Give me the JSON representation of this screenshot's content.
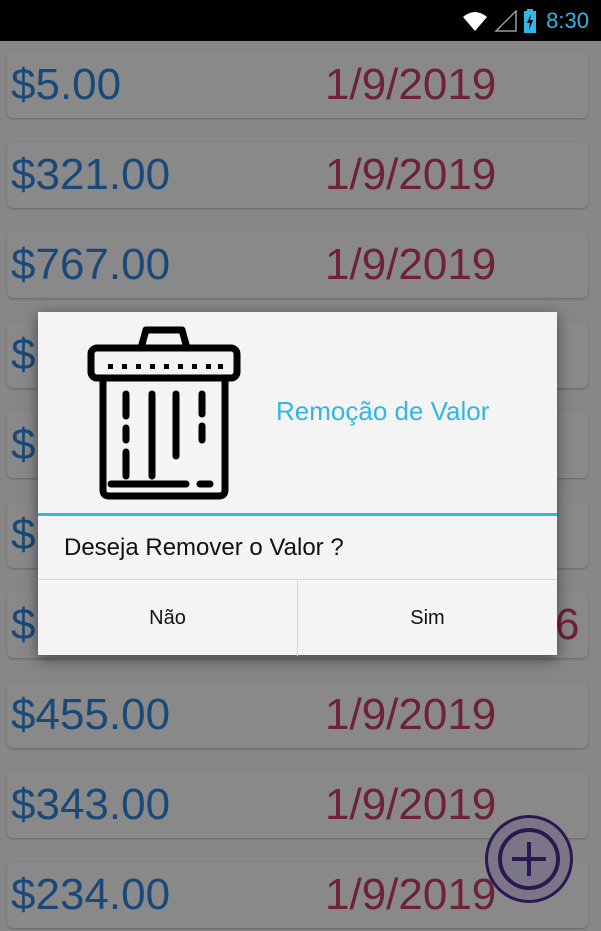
{
  "status_bar": {
    "time": "8:30",
    "accent": "#33b5e5"
  },
  "list": {
    "rows": [
      {
        "amount": "$5.00",
        "date": "1/9/2019"
      },
      {
        "amount": "$321.00",
        "date": "1/9/2019"
      },
      {
        "amount": "$767.00",
        "date": "1/9/2019"
      },
      {
        "amount": "$",
        "date": ""
      },
      {
        "amount": "$",
        "date": ""
      },
      {
        "amount": "$",
        "date": ""
      },
      {
        "amount": "$",
        "date": "6"
      },
      {
        "amount": "$455.00",
        "date": "1/9/2019"
      },
      {
        "amount": "$343.00",
        "date": "1/9/2019"
      },
      {
        "amount": "$234.00",
        "date": "1/9/2019"
      }
    ]
  },
  "dialog": {
    "title": "Remoção de Valor",
    "message": "Deseja Remover o Valor ?",
    "buttons": {
      "negative": "Não",
      "positive": "Sim"
    },
    "icon": "trash-can-icon"
  },
  "fab": {
    "icon": "plus-icon"
  },
  "colors": {
    "amount": "#2e7fd1",
    "date": "#c0395c",
    "dialog_accent": "#33b5e5",
    "fab": "#4a2a8c"
  }
}
